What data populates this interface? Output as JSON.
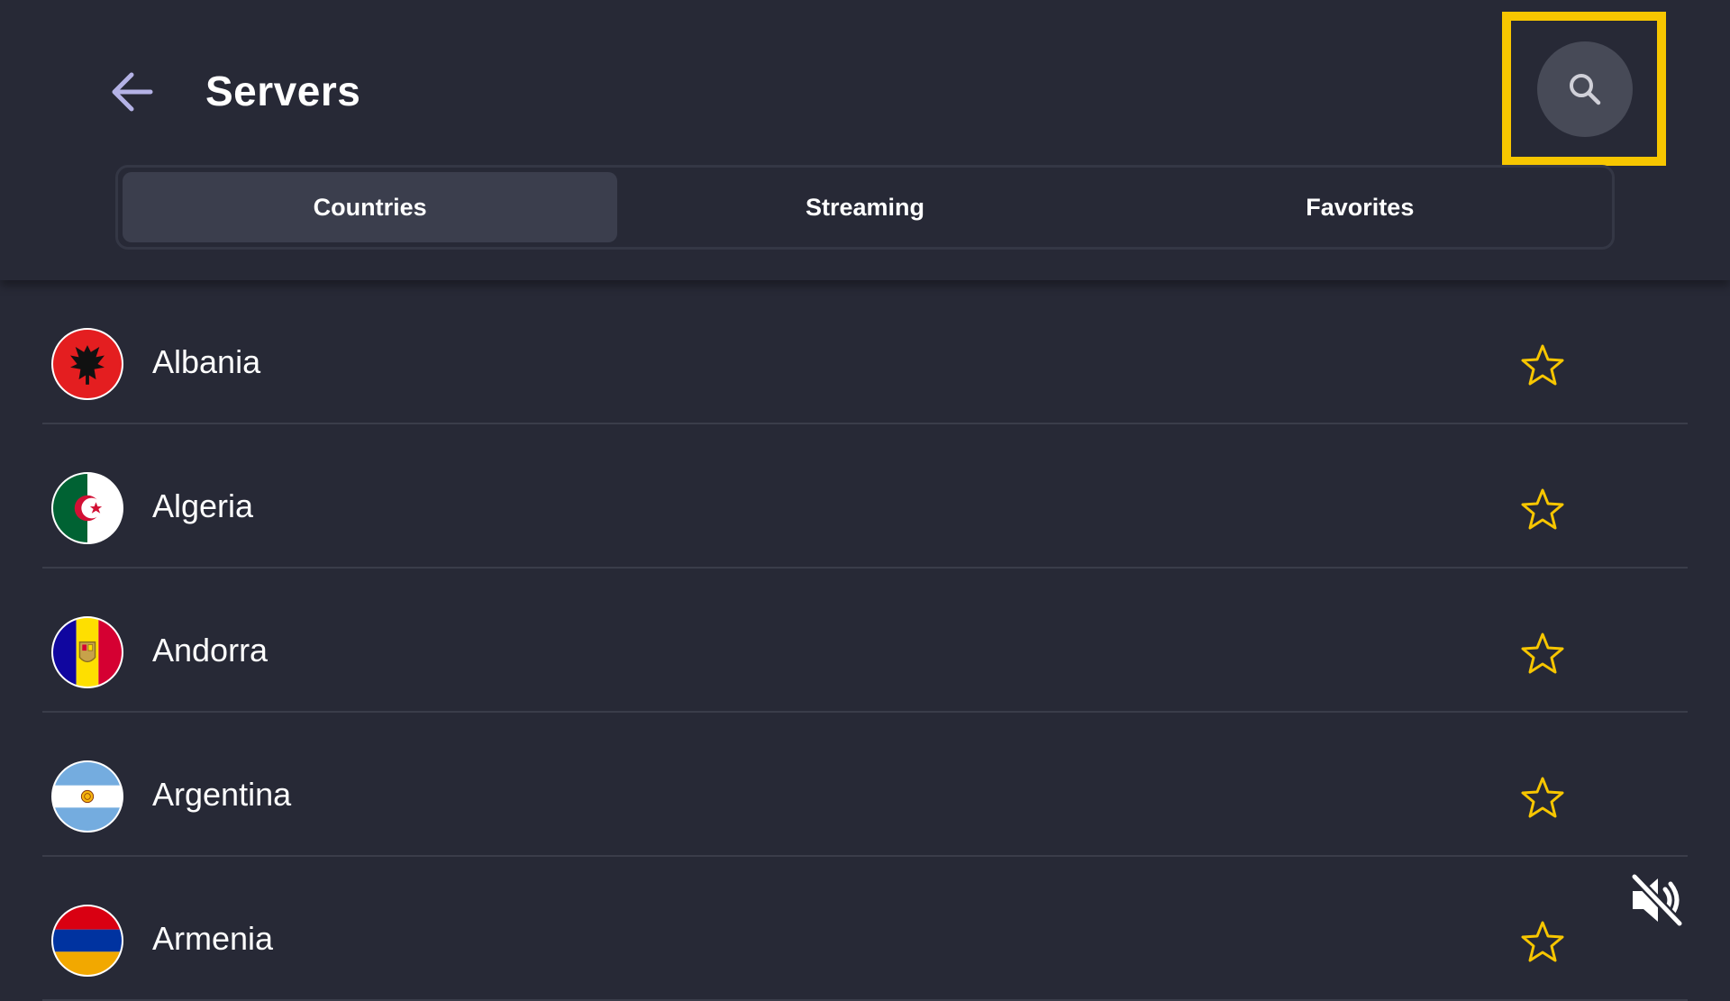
{
  "header": {
    "title": "Servers",
    "back_icon": "arrow-left-icon",
    "search_icon": "search-icon"
  },
  "tabs": [
    {
      "label": "Countries",
      "active": true
    },
    {
      "label": "Streaming",
      "active": false
    },
    {
      "label": "Favorites",
      "active": false
    }
  ],
  "countries": [
    {
      "name": "Albania",
      "flag": "albania-flag-icon"
    },
    {
      "name": "Algeria",
      "flag": "algeria-flag-icon"
    },
    {
      "name": "Andorra",
      "flag": "andorra-flag-icon"
    },
    {
      "name": "Argentina",
      "flag": "argentina-flag-icon"
    },
    {
      "name": "Armenia",
      "flag": "armenia-flag-icon"
    }
  ],
  "colors": {
    "background": "#272936",
    "accent": "#f7c600",
    "search_button": "#474a57",
    "active_tab": "#3b3e4d"
  },
  "overlay": {
    "mute_icon": "speaker-muted-icon"
  }
}
